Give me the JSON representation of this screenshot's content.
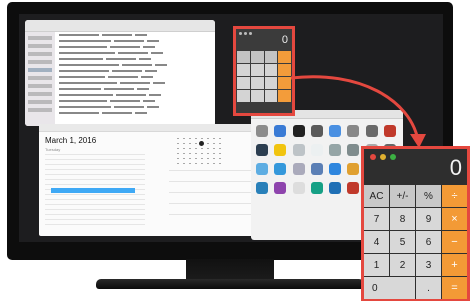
{
  "calendar": {
    "date_label": "March 1, 2016",
    "day_label": "Tuesday"
  },
  "calculator_small": {
    "display": "0"
  },
  "calculator_big": {
    "display": "0",
    "keys": [
      "AC",
      "+/-",
      "%",
      "÷",
      "7",
      "8",
      "9",
      "×",
      "4",
      "5",
      "6",
      "−",
      "1",
      "2",
      "3",
      "+",
      "0",
      ".",
      "="
    ]
  },
  "colors": {
    "highlight": "#e4483f",
    "operator": "#f39a36",
    "event": "#3fa9f5"
  }
}
